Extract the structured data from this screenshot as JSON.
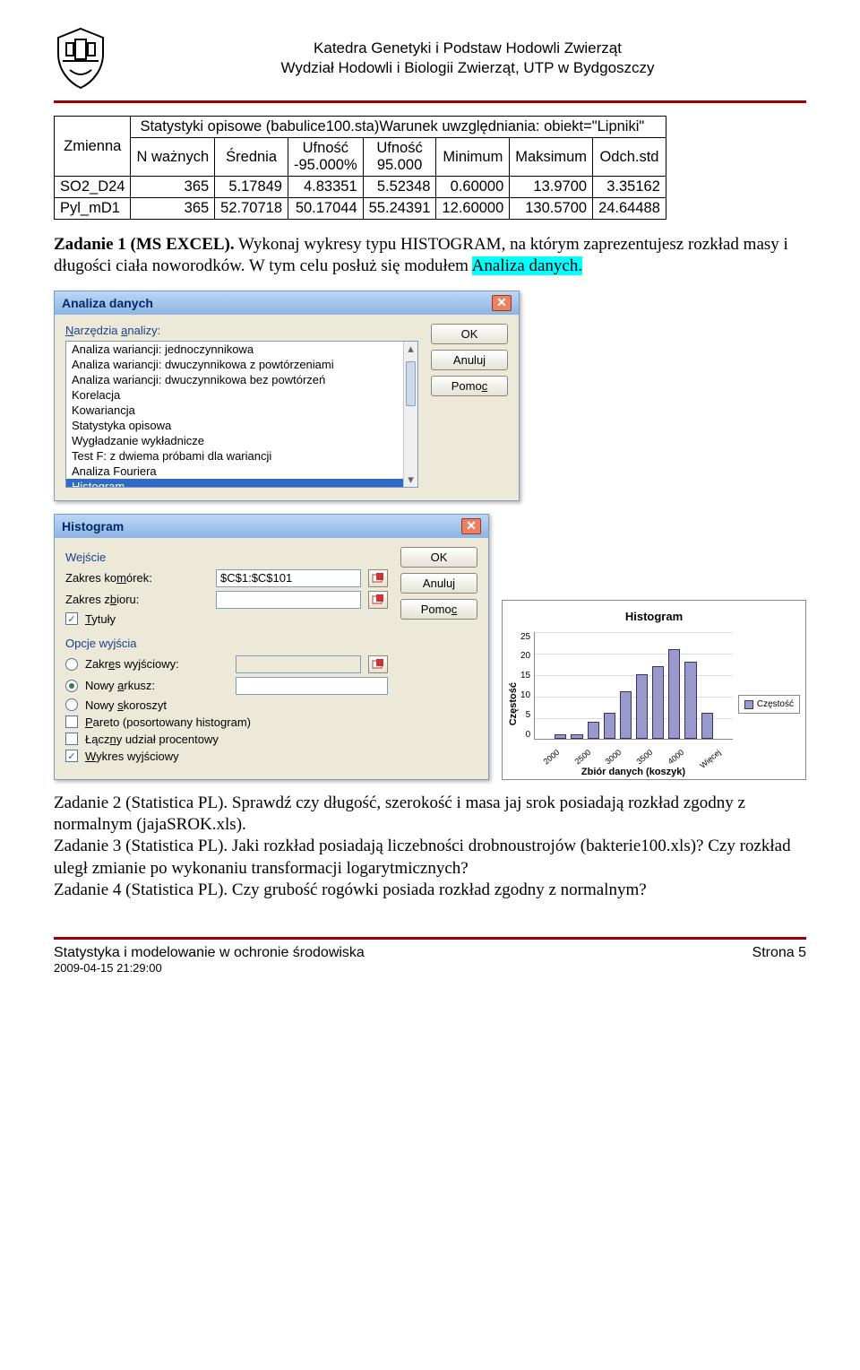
{
  "header": {
    "line1": "Katedra Genetyki i Podstaw Hodowli Zwierząt",
    "line2": "Wydział Hodowli i Biologii Zwierząt, UTP w Bydgoszczy"
  },
  "table": {
    "title": "Statystyki opisowe (babulice100.sta)Warunek uwzględniania: obiekt=\"Lipniki\"",
    "col0": "Zmienna",
    "headers": [
      "N ważnych",
      "Średnia",
      "Ufność\n-95.000%",
      "Ufność\n95.000",
      "Minimum",
      "Maksimum",
      "Odch.std"
    ],
    "rows": [
      {
        "label": "SO2_D24",
        "vals": [
          "365",
          "5.17849",
          "4.83351",
          "5.52348",
          "0.60000",
          "13.9700",
          "3.35162"
        ]
      },
      {
        "label": "Pyl_mD1",
        "vals": [
          "365",
          "52.70718",
          "50.17044",
          "55.24391",
          "12.60000",
          "130.5700",
          "24.64488"
        ]
      }
    ]
  },
  "task1": {
    "label": "Zadanie 1 (MS EXCEL).",
    "text": " Wykonaj wykresy typu HISTOGRAM, na którym zaprezentujesz rozkład masy i długości ciała noworodków. W tym celu posłuż się modułem ",
    "hl": "Analiza danych."
  },
  "dlg1": {
    "title": "Analiza danych",
    "tools_label": "Narzędzia analizy:",
    "items": [
      "Analiza wariancji: jednoczynnikowa",
      "Analiza wariancji: dwuczynnikowa z powtórzeniami",
      "Analiza wariancji: dwuczynnikowa bez powtórzeń",
      "Korelacja",
      "Kowariancja",
      "Statystyka opisowa",
      "Wygładzanie wykładnicze",
      "Test F: z dwiema próbami dla wariancji",
      "Analiza Fouriera",
      "Histogram"
    ],
    "ok": "OK",
    "cancel": "Anuluj",
    "help": "Pomoc"
  },
  "dlg2": {
    "title": "Histogram",
    "g_input": "Wejście",
    "cells_label": "Zakres komórek:",
    "cells_value": "$C$1:$C$101",
    "bins_label": "Zakres zbioru:",
    "titles": "Tytuły",
    "g_output": "Opcje wyjścia",
    "out_range": "Zakres wyjściowy:",
    "new_sheet": "Nowy arkusz:",
    "new_wb": "Nowy skoroszyt",
    "pareto": "Pareto (posortowany histogram)",
    "cumul": "Łączny udział procentowy",
    "chartout": "Wykres wyjściowy",
    "ok": "OK",
    "cancel": "Anuluj",
    "help": "Pomoc"
  },
  "chart_data": {
    "type": "bar",
    "title": "Histogram",
    "ylabel": "Częstość",
    "xlabel": "Zbiór danych (koszyk)",
    "ylim": [
      0,
      25
    ],
    "yticks": [
      0,
      5,
      10,
      15,
      20,
      25
    ],
    "categories": [
      "2000",
      "2500",
      "3000",
      "3500",
      "4000",
      "Więcej"
    ],
    "values": [
      0,
      1,
      1,
      4,
      6,
      11,
      15,
      17,
      21,
      18,
      6,
      0
    ],
    "legend": "Częstość"
  },
  "tasks_bottom": {
    "t2label": "Zadanie 2 (Statistica PL).",
    "t2": " Sprawdź czy długość, szerokość i masa jaj srok posiadają rozkład zgodny z normalnym (jajaSROK.xls).",
    "t3label": "Zadanie 3 (Statistica PL).",
    "t3": " Jaki rozkład posiadają liczebności drobnoustrojów (bakterie100.xls)? Czy rozkład uległ zmianie po wykonaniu transformacji logarytmicznych?",
    "t4label": "Zadanie 4 (Statistica PL).",
    "t4": " Czy grubość rogówki posiada rozkład zgodny z normalnym?"
  },
  "footer": {
    "left": "Statystyka i modelowanie w ochronie środowiska",
    "timestamp": "2009-04-15 21:29:00",
    "right": "Strona 5"
  }
}
